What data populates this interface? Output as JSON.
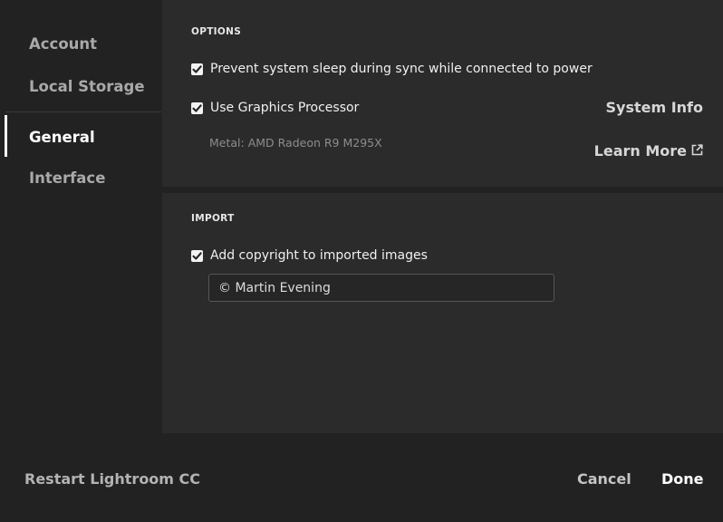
{
  "sidebar": {
    "items": [
      {
        "label": "Account"
      },
      {
        "label": "Local Storage"
      },
      {
        "label": "General"
      },
      {
        "label": "Interface"
      }
    ]
  },
  "options": {
    "title": "OPTIONS",
    "prevent_sleep_label": "Prevent system sleep during sync while connected to power",
    "prevent_sleep_checked": true,
    "gpu_label": "Use Graphics Processor",
    "gpu_checked": true,
    "gpu_info": "Metal: AMD Radeon R9 M295X",
    "system_info_label": "System Info",
    "learn_more_label": "Learn More"
  },
  "import": {
    "title": "IMPORT",
    "copyright_label": "Add copyright to imported images",
    "copyright_checked": true,
    "copyright_value": "© Martin Evening"
  },
  "footer": {
    "restart_label": "Restart Lightroom CC",
    "cancel_label": "Cancel",
    "done_label": "Done"
  },
  "colors": {
    "background": "#222222",
    "panel": "#2b2b2b",
    "active_text": "#ffffff",
    "inactive_text": "#a9a9a9"
  },
  "icons": {
    "checkbox": "checkmark-icon",
    "external": "external-link-icon"
  }
}
